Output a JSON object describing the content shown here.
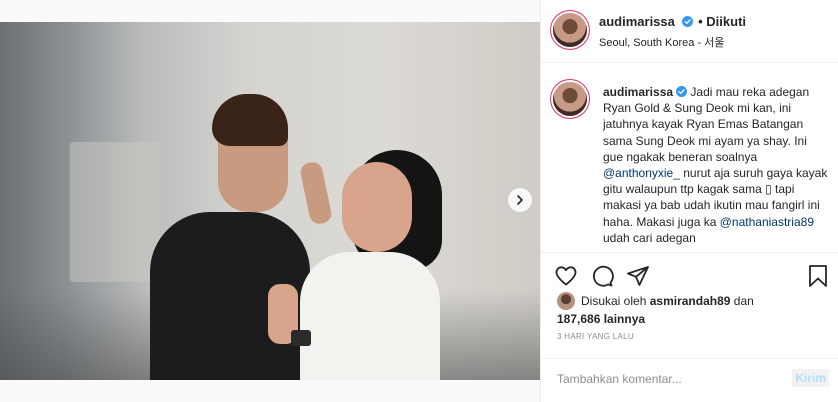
{
  "post": {
    "author": "audimarissa",
    "follow_status": "• Diikuti",
    "location": "Seoul, South Korea - 서울",
    "caption": {
      "author": "audimarissa",
      "text_1": "Jadi mau reka adegan Ryan Gold & Sung Deok mi kan, ini jatuhnya kayak Ryan Emas Batangan sama Sung Deok mi ayam ya shay. Ini gue ngakak beneran soalnya",
      "mention_1": "@anthonyxie_",
      "text_2": " nurut aja suruh gaya kayak gitu walaupun ttp kagak sama ▯ tapi makasi ya bab udah ikutin mau fangirl ini haha. Makasi juga ka",
      "mention_2": "@nathaniastria89",
      "text_3": " udah cari adegan"
    },
    "likes": {
      "prefix": "Disukai oleh",
      "user": "asmirandah89",
      "conj": "dan",
      "count": "187,686 lainnya"
    },
    "timestamp": "3 HARI YANG LALU",
    "carousel": {
      "total": 2,
      "active": 1
    }
  },
  "comment": {
    "placeholder": "Tambahkan komentar...",
    "post_label": "Kirim"
  },
  "icons": {
    "verified": "verified-badge-icon",
    "like": "heart-icon",
    "comment": "comment-bubble-icon",
    "share": "paper-plane-icon",
    "save": "bookmark-icon",
    "next": "chevron-right-icon"
  },
  "colors": {
    "verified": "#3897f0",
    "mention": "#00376b",
    "muted": "#8e8e8e"
  }
}
